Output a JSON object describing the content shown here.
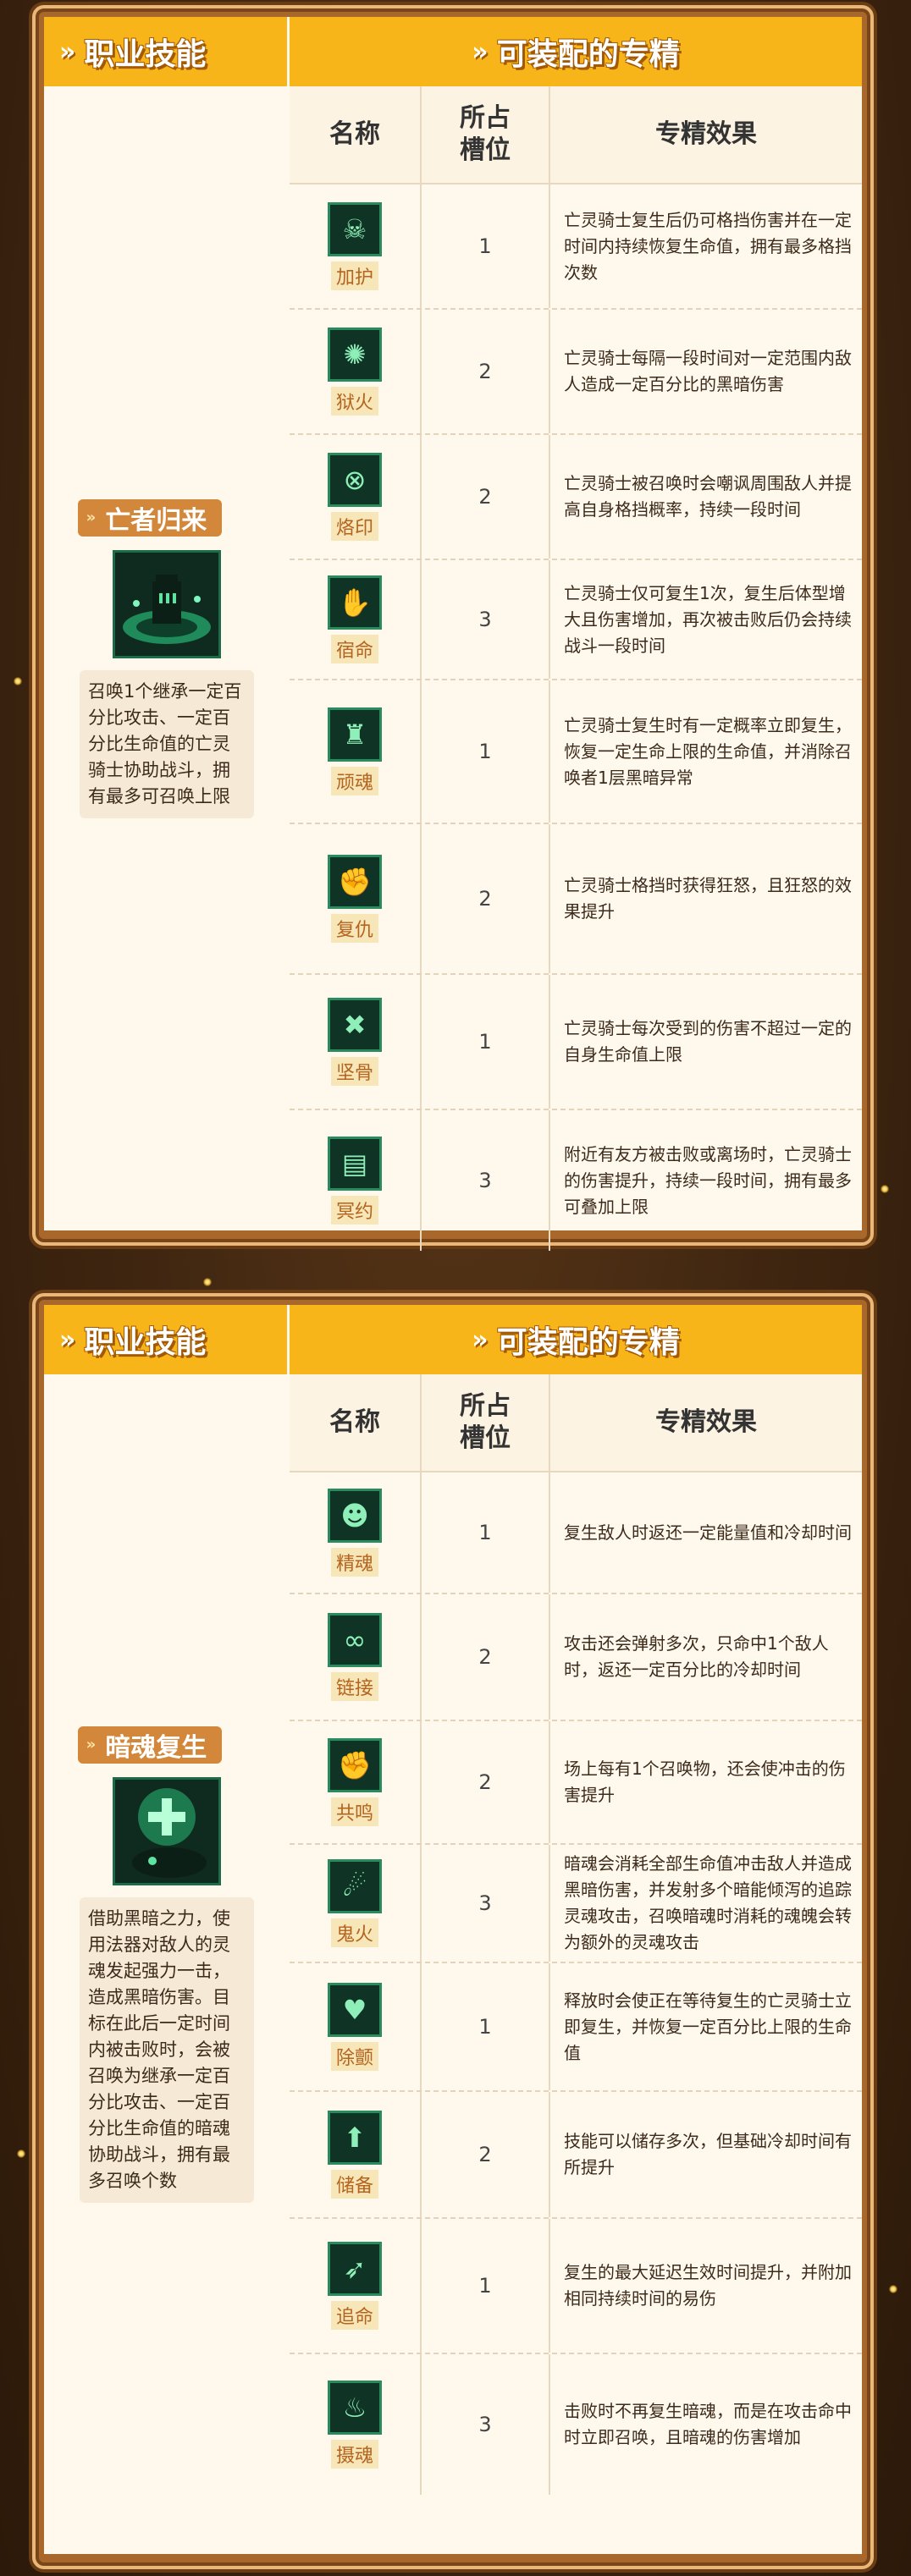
{
  "headers": {
    "class_skill": "职业技能",
    "specs": "可装配的专精",
    "col_name": "名称",
    "col_slot_line1": "所占",
    "col_slot_line2": "槽位",
    "col_effect": "专精效果"
  },
  "panels": [
    {
      "skill": {
        "name": "亡者归来",
        "icon": "undead-knight-summon-icon",
        "description": "召唤1个继承一定百分比攻击、一定百分比生命值的亡灵骑士协助战斗，拥有最多可召唤上限"
      },
      "specs": [
        {
          "name": "加护",
          "icon": "skull-shield-icon",
          "glyph": "☠",
          "slots": "1",
          "effect": "亡灵骑士复生后仍可格挡伤害并在一定时间内持续恢复生命值，拥有最多格挡次数"
        },
        {
          "name": "狱火",
          "icon": "hellfire-icon",
          "glyph": "✺",
          "slots": "2",
          "effect": "亡灵骑士每隔一段时间对一定范围内敌人造成一定百分比的黑暗伤害"
        },
        {
          "name": "烙印",
          "icon": "brand-seal-icon",
          "glyph": "⊗",
          "slots": "2",
          "effect": "亡灵骑士被召唤时会嘲讽周围敌人并提高自身格挡概率，持续一段时间"
        },
        {
          "name": "宿命",
          "icon": "hand-icon",
          "glyph": "✋",
          "slots": "3",
          "effect": "亡灵骑士仅可复生1次，复生后体型增大且伤害增加，再次被击败后仍会持续战斗一段时间"
        },
        {
          "name": "顽魂",
          "icon": "stubborn-soul-icon",
          "glyph": "♜",
          "slots": "1",
          "effect": "亡灵骑士复生时有一定概率立即复生，恢复一定生命上限的生命值，并消除召唤者1层黑暗异常"
        },
        {
          "name": "复仇",
          "icon": "vengeance-icon",
          "glyph": "✊",
          "slots": "2",
          "effect": "亡灵骑士格挡时获得狂怒，且狂怒的效果提升"
        },
        {
          "name": "坚骨",
          "icon": "crossed-bones-icon",
          "glyph": "✖",
          "slots": "1",
          "effect": "亡灵骑士每次受到的伤害不超过一定的自身生命值上限"
        },
        {
          "name": "冥约",
          "icon": "scroll-pact-icon",
          "glyph": "▤",
          "slots": "3",
          "effect": "附近有友方被击败或离场时，亡灵骑士的伤害提升，持续一段时间，拥有最多可叠加上限"
        }
      ]
    },
    {
      "skill": {
        "name": "暗魂复生",
        "icon": "dark-soul-revive-icon",
        "description": "借助黑暗之力，使用法器对敌人的灵魂发起强力一击，造成黑暗伤害。目标在此后一定时间内被击败时，会被召唤为继承一定百分比攻击、一定百分比生命值的暗魂协助战斗，拥有最多召唤个数"
      },
      "specs": [
        {
          "name": "精魂",
          "icon": "spirit-beast-icon",
          "glyph": "☻",
          "slots": "1",
          "effect": "复生敌人时返还一定能量值和冷却时间"
        },
        {
          "name": "链接",
          "icon": "chain-link-icon",
          "glyph": "∞",
          "slots": "2",
          "effect": "攻击还会弹射多次，只命中1个敌人时，返还一定百分比的冷却时间"
        },
        {
          "name": "共鸣",
          "icon": "resonance-fist-icon",
          "glyph": "✊",
          "slots": "2",
          "effect": "场上每有1个召唤物，还会使冲击的伤害提升"
        },
        {
          "name": "鬼火",
          "icon": "ghost-fire-icon",
          "glyph": "☄",
          "slots": "3",
          "effect": "暗魂会消耗全部生命值冲击敌人并造成黑暗伤害，并发射多个暗能倾泻的追踪灵魂攻击，召唤暗魂时消耗的魂魄会转为额外的灵魂攻击"
        },
        {
          "name": "除颤",
          "icon": "heartbeat-icon",
          "glyph": "♥",
          "slots": "1",
          "effect": "释放时会使正在等待复生的亡灵骑士立即复生，并恢复一定百分比上限的生命值"
        },
        {
          "name": "储备",
          "icon": "upload-arrow-icon",
          "glyph": "⬆",
          "slots": "2",
          "effect": "技能可以储存多次，但基础冷却时间有所提升"
        },
        {
          "name": "追命",
          "icon": "chasing-blade-icon",
          "glyph": "➶",
          "slots": "1",
          "effect": "复生的最大延迟生效时间提升，并附加相同持续时间的易伤"
        },
        {
          "name": "摄魂",
          "icon": "soul-flame-icon",
          "glyph": "♨",
          "slots": "3",
          "effect": "击败时不再复生暗魂，而是在攻击命中时立即召唤，且暗魂的伤害增加"
        }
      ]
    }
  ]
}
